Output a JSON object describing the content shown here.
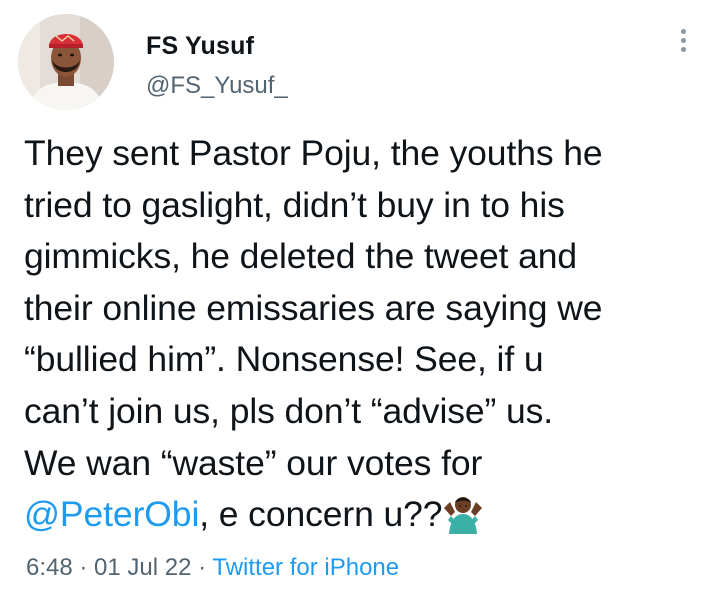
{
  "author": {
    "display_name": "FS Yusuf",
    "handle": "@FS_Yusuf_"
  },
  "tweet": {
    "lines": [
      "They sent Pastor Poju, the youths he",
      "tried to gaslight, didn’t buy in to his",
      "gimmicks, he deleted the tweet and",
      "their online emissaries are saying we",
      "“bullied him”. Nonsense! See, if u",
      "can’t join us, pls don’t “advise” us.",
      "We wan “waste” our votes for"
    ],
    "mention": "@PeterObi",
    "last_line_rest": ", e concern u??",
    "emoji": "person-shrugging-icon"
  },
  "meta": {
    "time": "6:48",
    "dot1": " · ",
    "date": "01 Jul 22",
    "dot2": " · ",
    "source": "Twitter for iPhone"
  },
  "colors": {
    "link": "#1d9bf0",
    "secondary_text": "#536471",
    "primary_text": "#0f1419"
  },
  "icons": {
    "more": "more-options-icon",
    "avatar": "avatar"
  }
}
